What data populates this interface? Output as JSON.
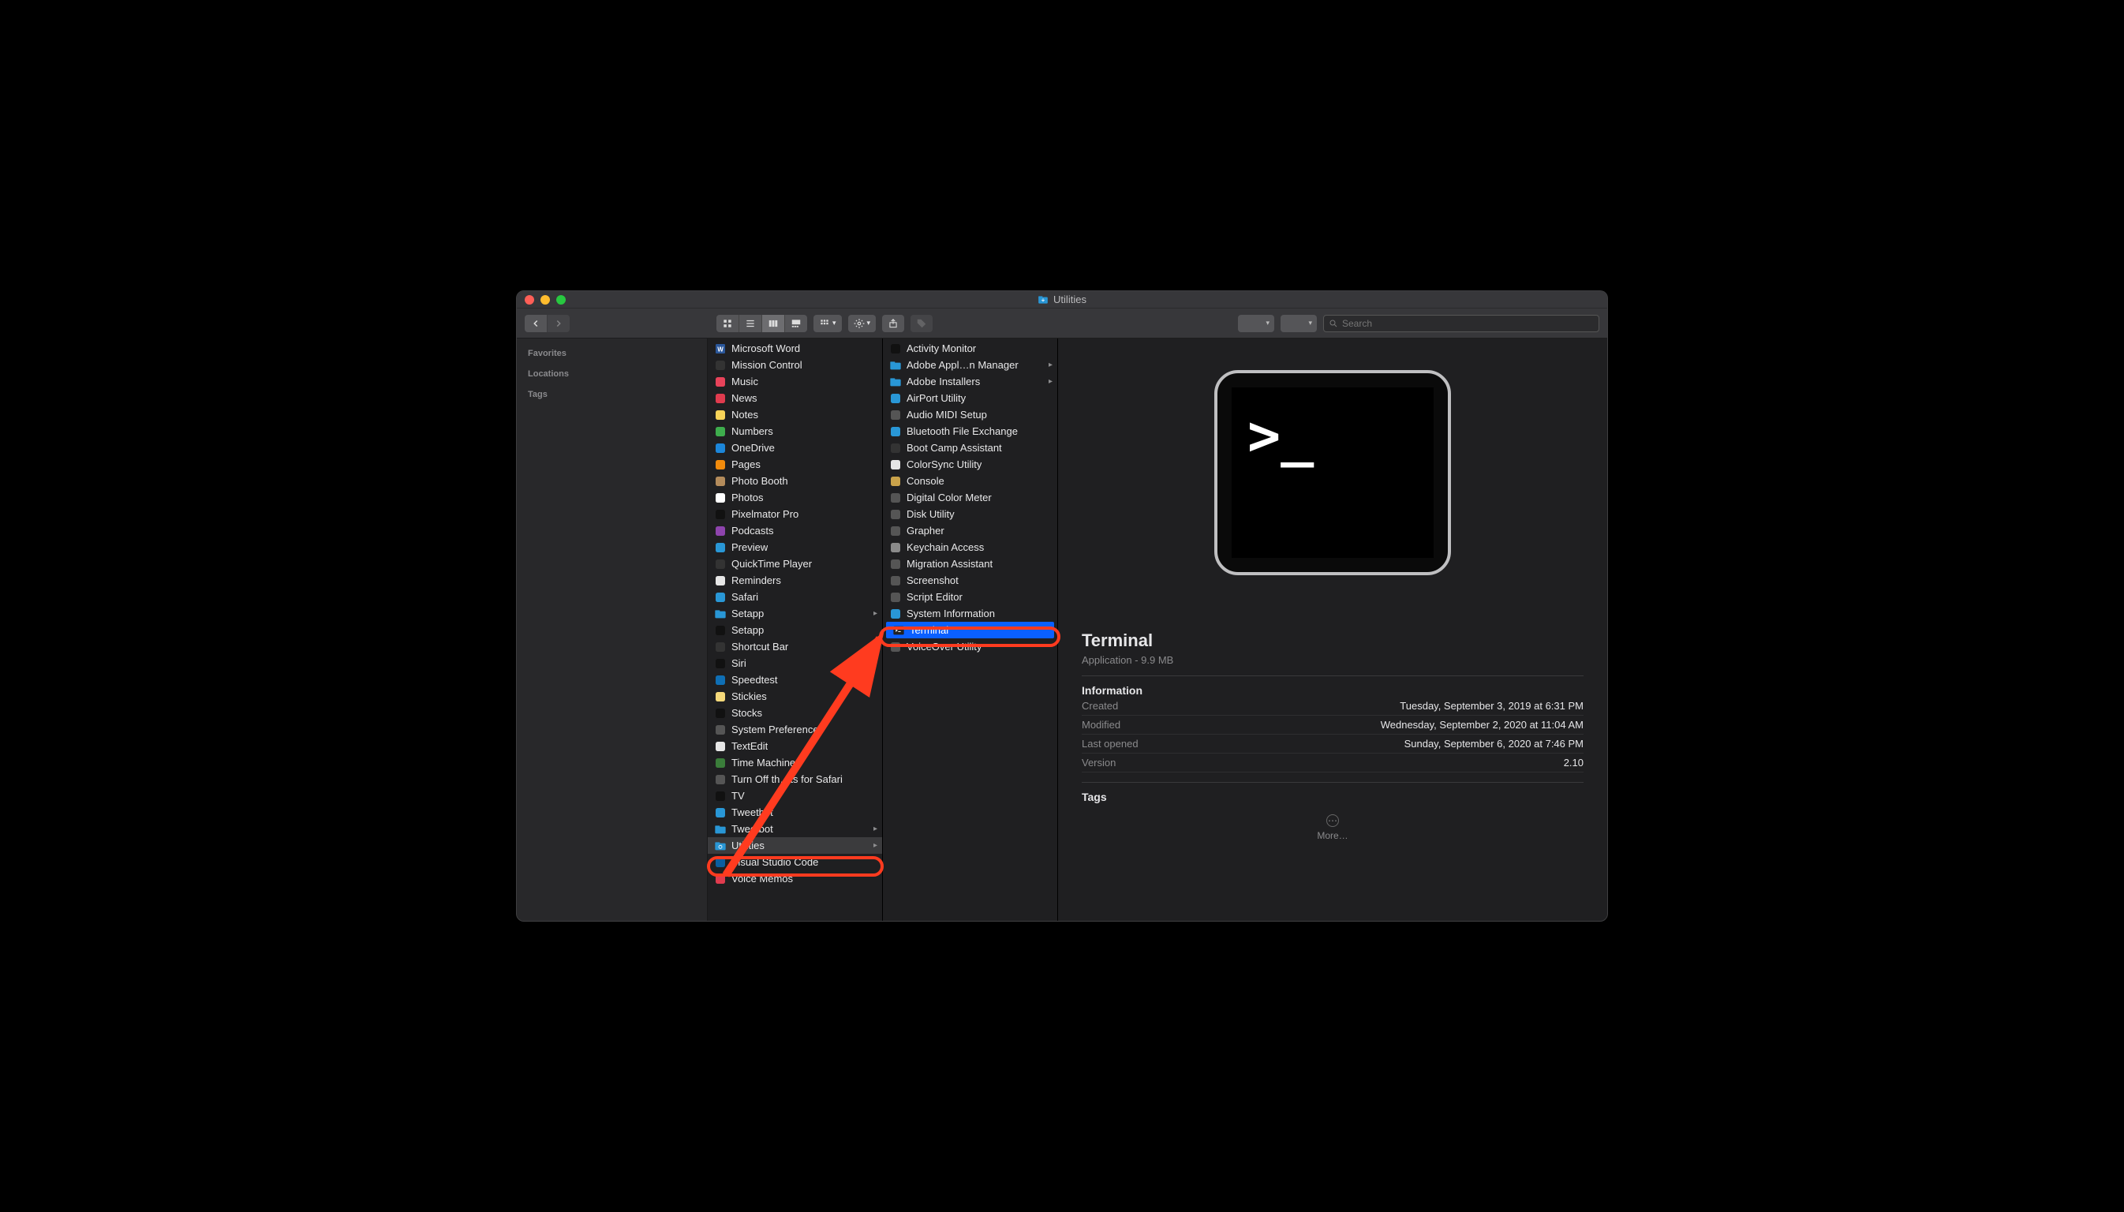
{
  "window": {
    "title": "Utilities"
  },
  "toolbar": {
    "search_placeholder": "Search"
  },
  "sidebar": {
    "headings": [
      "Favorites",
      "Locations",
      "Tags"
    ]
  },
  "col_apps": [
    {
      "label": "Microsoft Word",
      "icon": "word"
    },
    {
      "label": "Mission Control",
      "icon": "mission"
    },
    {
      "label": "Music",
      "icon": "music"
    },
    {
      "label": "News",
      "icon": "news"
    },
    {
      "label": "Notes",
      "icon": "notes"
    },
    {
      "label": "Numbers",
      "icon": "numbers"
    },
    {
      "label": "OneDrive",
      "icon": "cloud"
    },
    {
      "label": "Pages",
      "icon": "pages"
    },
    {
      "label": "Photo Booth",
      "icon": "photobooth"
    },
    {
      "label": "Photos",
      "icon": "photos"
    },
    {
      "label": "Pixelmator Pro",
      "icon": "pixelmator"
    },
    {
      "label": "Podcasts",
      "icon": "podcasts"
    },
    {
      "label": "Preview",
      "icon": "preview"
    },
    {
      "label": "QuickTime Player",
      "icon": "qt"
    },
    {
      "label": "Reminders",
      "icon": "reminders"
    },
    {
      "label": "Safari",
      "icon": "safari"
    },
    {
      "label": "Setapp",
      "icon": "folder",
      "chevron": true
    },
    {
      "label": "Setapp",
      "icon": "setapp"
    },
    {
      "label": "Shortcut Bar",
      "icon": "shortcut"
    },
    {
      "label": "Siri",
      "icon": "siri"
    },
    {
      "label": "Speedtest",
      "icon": "speed"
    },
    {
      "label": "Stickies",
      "icon": "stickies"
    },
    {
      "label": "Stocks",
      "icon": "stocks"
    },
    {
      "label": "System Preferences",
      "icon": "sysprefs"
    },
    {
      "label": "TextEdit",
      "icon": "textedit"
    },
    {
      "label": "Time Machine",
      "icon": "timemachine"
    },
    {
      "label": "Turn Off th…ts for Safari",
      "icon": "bulb"
    },
    {
      "label": "TV",
      "icon": "tv"
    },
    {
      "label": "Tweetbot",
      "icon": "tweetbot"
    },
    {
      "label": "Tweetbot",
      "icon": "folder",
      "chevron": true
    },
    {
      "label": "Utilities",
      "icon": "util-folder",
      "chevron": true,
      "selected": "gray"
    },
    {
      "label": "Visual Studio Code",
      "icon": "vscode"
    },
    {
      "label": "Voice Memos",
      "icon": "voicememos"
    }
  ],
  "col_utils": [
    {
      "label": "Activity Monitor",
      "icon": "activity"
    },
    {
      "label": "Adobe Appl…n Manager",
      "icon": "folder",
      "chevron": true
    },
    {
      "label": "Adobe Installers",
      "icon": "folder",
      "chevron": true
    },
    {
      "label": "AirPort Utility",
      "icon": "airport"
    },
    {
      "label": "Audio MIDI Setup",
      "icon": "midi"
    },
    {
      "label": "Bluetooth File Exchange",
      "icon": "bt"
    },
    {
      "label": "Boot Camp Assistant",
      "icon": "bootcamp"
    },
    {
      "label": "ColorSync Utility",
      "icon": "colorsync"
    },
    {
      "label": "Console",
      "icon": "console"
    },
    {
      "label": "Digital Color Meter",
      "icon": "colormeter"
    },
    {
      "label": "Disk Utility",
      "icon": "disk"
    },
    {
      "label": "Grapher",
      "icon": "grapher"
    },
    {
      "label": "Keychain Access",
      "icon": "keychain"
    },
    {
      "label": "Migration Assistant",
      "icon": "migration"
    },
    {
      "label": "Screenshot",
      "icon": "screenshot"
    },
    {
      "label": "Script Editor",
      "icon": "script"
    },
    {
      "label": "System Information",
      "icon": "sysinfo"
    },
    {
      "label": "Terminal",
      "icon": "terminal",
      "selected": "blue"
    },
    {
      "label": "VoiceOver Utility",
      "icon": "voiceover"
    }
  ],
  "preview": {
    "name": "Terminal",
    "subtitle": "Application - 9.9 MB",
    "section_info": "Information",
    "rows": [
      {
        "k": "Created",
        "v": "Tuesday, September 3, 2019 at 6:31 PM"
      },
      {
        "k": "Modified",
        "v": "Wednesday, September 2, 2020 at 11:04 AM"
      },
      {
        "k": "Last opened",
        "v": "Sunday, September 6, 2020 at 7:46 PM"
      },
      {
        "k": "Version",
        "v": "2.10"
      }
    ],
    "section_tags": "Tags",
    "more": "More…"
  }
}
